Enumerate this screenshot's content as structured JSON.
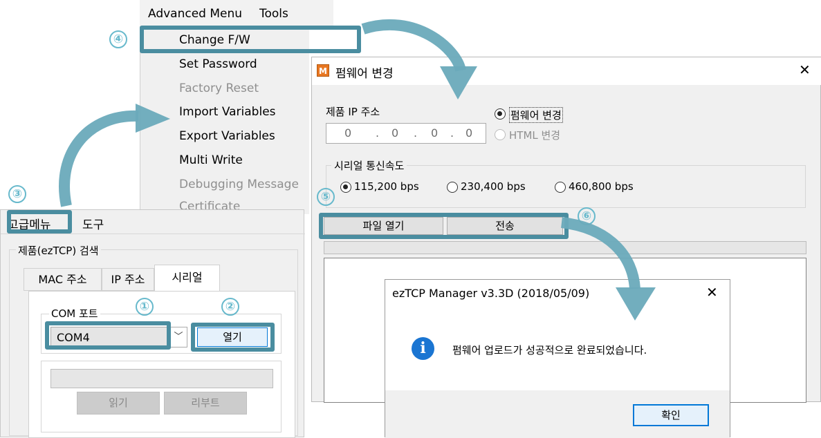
{
  "menubar": {
    "items": [
      "Advanced Menu",
      "Tools"
    ]
  },
  "advanced_menu": {
    "items": [
      {
        "label": "Change F/W",
        "disabled": false
      },
      {
        "label": "Set Password",
        "disabled": false
      },
      {
        "label": "Factory Reset",
        "disabled": true
      },
      {
        "label": "Import Variables",
        "disabled": false
      },
      {
        "label": "Export Variables",
        "disabled": false
      },
      {
        "label": "Multi Write",
        "disabled": false
      },
      {
        "label": "Debugging Message",
        "disabled": true
      },
      {
        "label": "Certificate",
        "disabled": true
      }
    ]
  },
  "steps": [
    "①",
    "②",
    "③",
    "④",
    "⑤",
    "⑥"
  ],
  "firmware_window": {
    "logo": "M",
    "title": "펌웨어 변경",
    "close": "✕",
    "ip_label": "제품 IP 주소",
    "ip_octets": [
      "0",
      "0",
      "0",
      "0"
    ],
    "ip_dots": ".",
    "mode_options": [
      {
        "label": "펌웨어 변경",
        "selected": true,
        "enabled": true
      },
      {
        "label": "HTML 변경",
        "selected": false,
        "enabled": false
      }
    ],
    "baud_group_label": "시리얼 통신속도",
    "baud_options": [
      {
        "label": "115,200 bps",
        "selected": true
      },
      {
        "label": "230,400 bps",
        "selected": false
      },
      {
        "label": "460,800 bps",
        "selected": false
      }
    ],
    "open_file_button": "파일 열기",
    "send_button": "전송"
  },
  "korean_window": {
    "menubar": [
      "고급메뉴",
      "도구"
    ],
    "search_group": "제품(ezTCP) 검색",
    "tabs": [
      "MAC 주소",
      "IP 주소",
      "시리얼"
    ],
    "active_tab": "시리얼",
    "com_group": "COM 포트",
    "com_value": "COM4",
    "open_button": "열기",
    "read_button": "읽기",
    "reboot_button": "리부트"
  },
  "dialog": {
    "title": "ezTCP Manager v3.3D (2018/05/09)",
    "close": "✕",
    "icon": "info-icon",
    "message": "펌웨어 업로드가 성공적으로 완료되었습니다.",
    "ok_button": "확인"
  },
  "colors": {
    "highlight": "#4a8da0",
    "arrow": "#6aaabb",
    "step_number": "#67b9cc",
    "logo": "#e87722",
    "info_icon": "#1a75d2"
  }
}
